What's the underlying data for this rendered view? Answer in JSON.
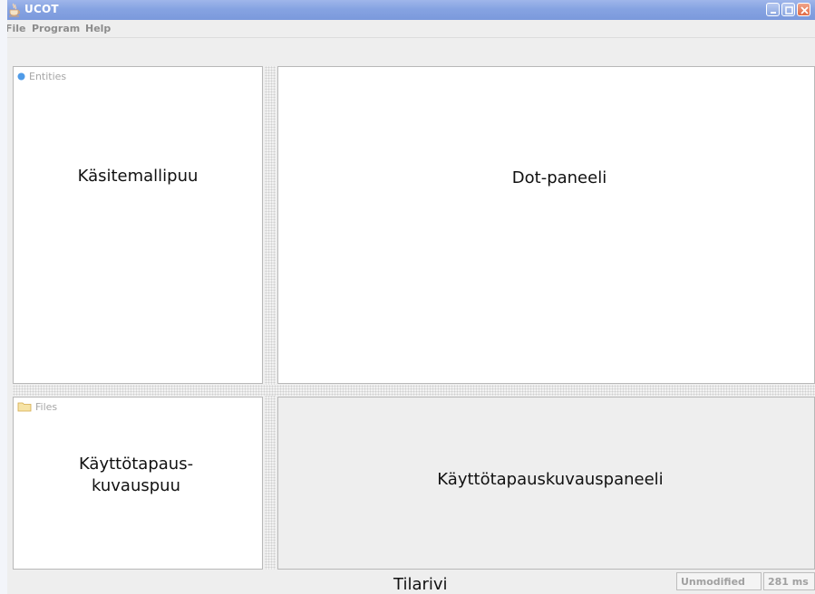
{
  "window": {
    "title": "UCOT",
    "controls": [
      "minimize",
      "maximize",
      "close"
    ],
    "icon": "java-cup-icon"
  },
  "menubar": {
    "items": [
      {
        "label": "File"
      },
      {
        "label": "Program"
      },
      {
        "label": "Help"
      }
    ]
  },
  "entities_panel": {
    "header": "Entities",
    "icon": "circle-node-icon",
    "label": "Käsitemallipuu"
  },
  "dot_panel": {
    "label": "Dot-paneeli"
  },
  "files_panel": {
    "header": "Files",
    "icon": "folder-icon",
    "label_line1": "Käyttötapaus-",
    "label_line2": "kuvauspuu"
  },
  "usecase_panel": {
    "label": "Käyttötapauskuvauspaneeli"
  },
  "statusbar": {
    "label": "Tilarivi",
    "state": "Unmodified",
    "time": "281 ms"
  },
  "colors": {
    "titlebar": "#86a3e2",
    "menu_text": "#8c8c8c",
    "entity_dot": "#4f9be8",
    "folder": "#e9c56b"
  }
}
